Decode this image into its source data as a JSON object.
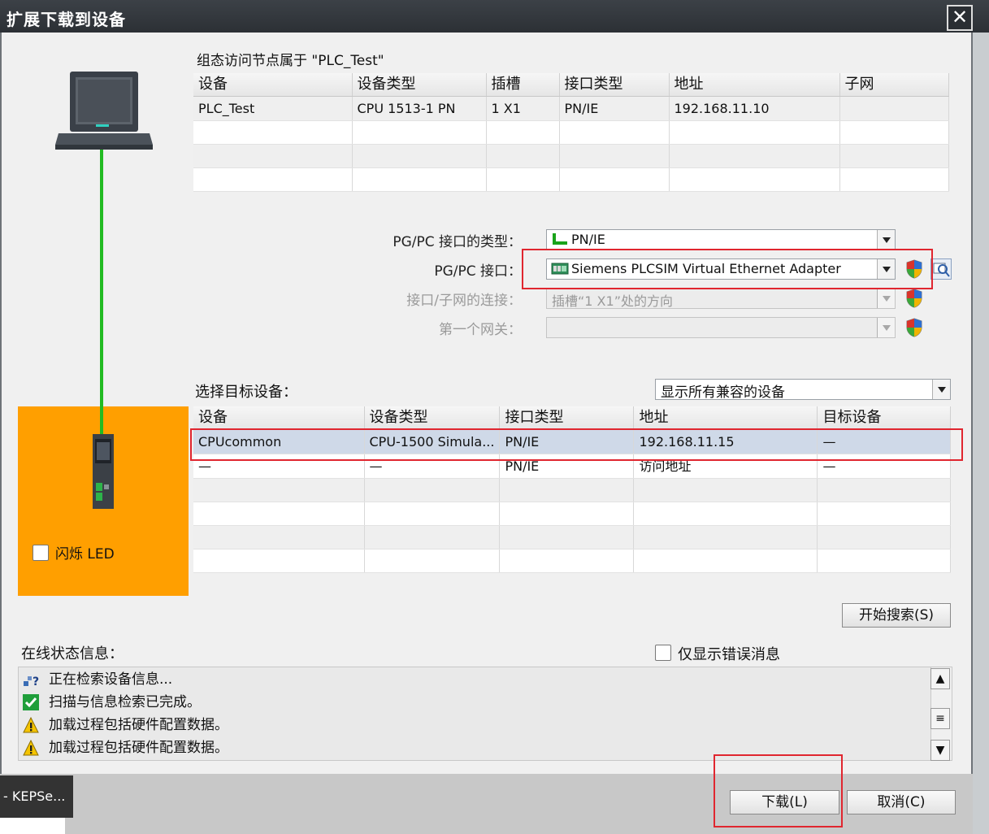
{
  "window": {
    "title": "扩展下载到设备",
    "close_glyph": "✕"
  },
  "config_access": {
    "caption": "组态访问节点属于 \"PLC_Test\"",
    "columns": [
      "设备",
      "设备类型",
      "插槽",
      "接口类型",
      "地址",
      "子网"
    ],
    "rows": [
      [
        "PLC_Test",
        "CPU 1513-1 PN",
        "1 X1",
        "PN/IE",
        "192.168.11.10",
        ""
      ],
      [
        "",
        "",
        "",
        "",
        "",
        ""
      ],
      [
        "",
        "",
        "",
        "",
        "",
        ""
      ],
      [
        "",
        "",
        "",
        "",
        "",
        ""
      ]
    ]
  },
  "pgpc": {
    "type_label": "PG/PC 接口的类型：",
    "type_value": "PN/IE",
    "interface_label": "PG/PC 接口：",
    "interface_value": "Siemens PLCSIM Virtual Ethernet Adapter",
    "subnet_label": "接口/子网的连接：",
    "subnet_value": "插槽“1 X1”处的方向",
    "gateway_label": "第一个网关：",
    "gateway_value": ""
  },
  "target": {
    "label": "选择目标设备：",
    "filter_value": "显示所有兼容的设备",
    "columns": [
      "设备",
      "设备类型",
      "接口类型",
      "地址",
      "目标设备"
    ],
    "rows": [
      [
        "CPUcommon",
        "CPU-1500 Simula...",
        "PN/IE",
        "192.168.11.15",
        "—"
      ],
      [
        "—",
        "—",
        "PN/IE",
        "访问地址",
        "—"
      ],
      [
        "",
        "",
        "",
        "",
        ""
      ],
      [
        "",
        "",
        "",
        "",
        ""
      ],
      [
        "",
        "",
        "",
        "",
        ""
      ],
      [
        "",
        "",
        "",
        "",
        ""
      ]
    ]
  },
  "flash_led": {
    "label": "闪烁 LED"
  },
  "search_button": "开始搜索(S)",
  "status": {
    "title": "在线状态信息：",
    "errors_only_label": "仅显示错误消息",
    "messages": [
      {
        "icon": "search-network-icon",
        "text": "正在检索设备信息..."
      },
      {
        "icon": "check-icon",
        "text": "扫描与信息检索已完成。"
      },
      {
        "icon": "warning-icon",
        "text": "加载过程包括硬件配置数据。"
      },
      {
        "icon": "warning-icon",
        "text": "加载过程包括硬件配置数据。"
      }
    ]
  },
  "buttons": {
    "download": "下载(L)",
    "cancel": "取消(C)"
  },
  "taskbar": {
    "item": "- KEPSe..."
  },
  "colors": {
    "orange_panel": "#ff9f00",
    "link_line": "#22bb22",
    "highlight_red": "#e0262f"
  }
}
